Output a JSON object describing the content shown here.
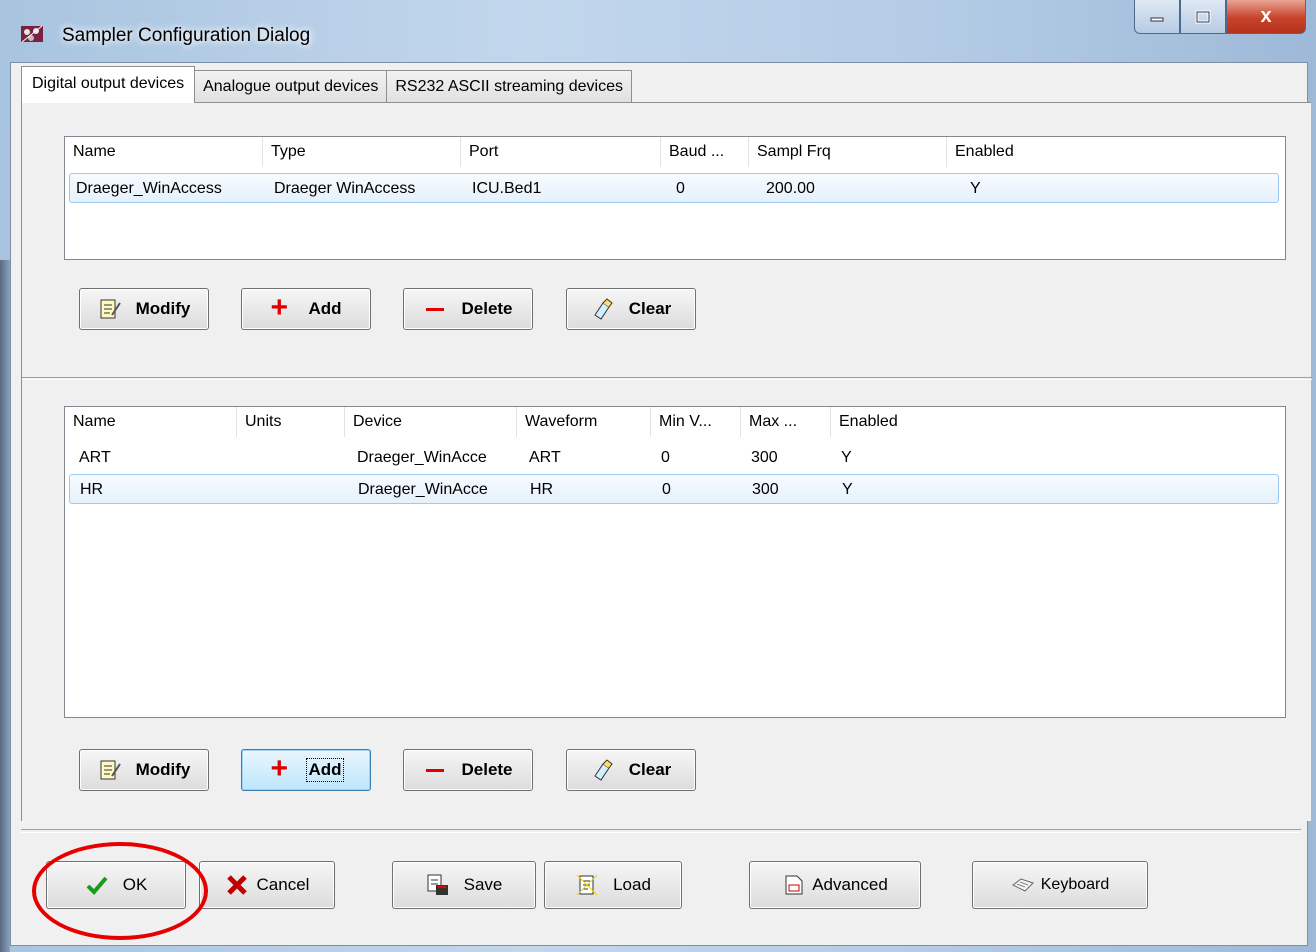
{
  "window": {
    "title": "Sampler Configuration Dialog",
    "close_glyph": "x"
  },
  "tabs": [
    {
      "label": "Digital output devices",
      "active": true
    },
    {
      "label": "Analogue output devices",
      "active": false
    },
    {
      "label": "RS232 ASCII streaming devices",
      "active": false
    }
  ],
  "devices": {
    "columns": [
      "Name",
      "Type",
      "Port",
      "Baud ...",
      "Sampl Frq",
      "Enabled"
    ],
    "rows": [
      [
        "Draeger_WinAccess",
        "Draeger WinAccess",
        "ICU.Bed1",
        "0",
        "200.00",
        "Y"
      ]
    ],
    "buttons": {
      "modify": "Modify",
      "add": "Add",
      "delete": "Delete",
      "clear": "Clear"
    }
  },
  "signals": {
    "columns": [
      "Name",
      "Units",
      "Device",
      "Waveform",
      "Min V...",
      "Max ...",
      "Enabled"
    ],
    "rows": [
      [
        "ART",
        "",
        "Draeger_WinAcce",
        "ART",
        "0",
        "300",
        "Y"
      ],
      [
        "HR",
        "",
        "Draeger_WinAcce",
        "HR",
        "0",
        "300",
        "Y"
      ]
    ],
    "buttons": {
      "modify": "Modify",
      "add": "Add",
      "delete": "Delete",
      "clear": "Clear"
    }
  },
  "footer": {
    "ok": "OK",
    "cancel": "Cancel",
    "save": "Save",
    "load": "Load",
    "advanced": "Advanced",
    "keyboard": "Keyboard"
  },
  "colors": {
    "add_plus": "#e00000",
    "delete_minus": "#e00000",
    "ok_check": "#1a9a1a",
    "cancel_x": "#c00000",
    "highlight_ring": "#e60000"
  }
}
